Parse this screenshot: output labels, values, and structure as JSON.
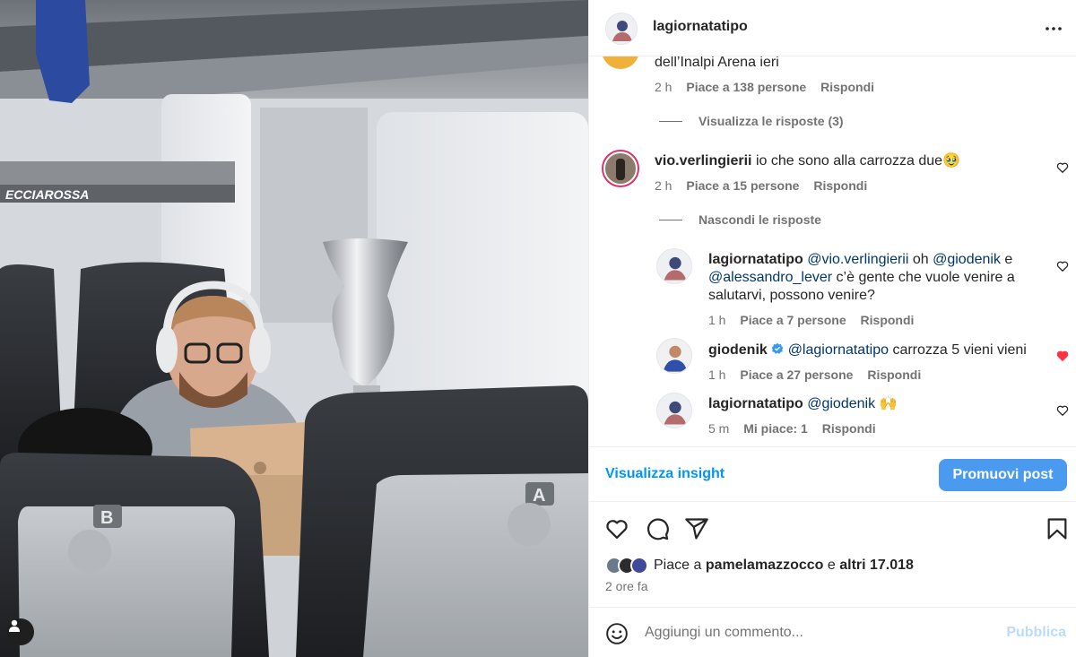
{
  "header": {
    "username": "lagiornatatipo"
  },
  "comments": [
    {
      "id": "c0",
      "partial_text": "dell’Inalpi Arena ieri",
      "time": "2 h",
      "likes": "Piace a 138 persone",
      "reply": "Rispondi",
      "toggle": "Visualizza le risposte (3)"
    },
    {
      "id": "c1",
      "username": "vio.verlingierii",
      "text": "io che sono alla carrozza due🥹",
      "time": "2 h",
      "likes": "Piace a 15 persone",
      "reply": "Rispondi",
      "toggle": "Nascondi le risposte"
    }
  ],
  "replies": [
    {
      "username": "lagiornatatipo",
      "mention1": "@vio.verlingierii",
      "text1": " oh ",
      "mention2": "@giodenik",
      "text2": " e",
      "mention3": "@alessandro_lever",
      "text3": " c’è gente che vuole venire a",
      "text4": "salutarvi, possono venire?",
      "time": "1 h",
      "likes": "Piace a 7 persone",
      "reply": "Rispondi"
    },
    {
      "username": "giodenik",
      "verified": true,
      "mention": "@lagiornatatipo",
      "text": " carrozza 5 vieni vieni",
      "time": "1 h",
      "likes": "Piace a 27 persone",
      "reply": "Rispondi",
      "liked": true
    },
    {
      "username": "lagiornatatipo",
      "mention": "@giodenik",
      "text": " 🙌",
      "time": "5 m",
      "likes": "Mi piace: 1",
      "reply": "Rispondi"
    }
  ],
  "insight": {
    "link": "Visualizza insight",
    "promote": "Promuovi post"
  },
  "likes": {
    "prefix": "Piace a ",
    "user": "pamelamazzocco",
    "middle": " e ",
    "others": "altri 17.018",
    "time": "2 ore fa"
  },
  "add_comment": {
    "placeholder": "Aggiungi un commento...",
    "publish": "Pubblica"
  },
  "photo": {
    "train_logo_text": "ECCIAROSSA"
  },
  "colors": {
    "accent": "#0095f6",
    "liked_heart": "#ff3040",
    "mention": "#00376b",
    "meta": "#737373"
  },
  "icons": [
    "more-icon",
    "heart-icon",
    "comment-icon",
    "share-icon",
    "bookmark-icon",
    "emoji-icon",
    "verified-icon",
    "user-tag-icon"
  ]
}
